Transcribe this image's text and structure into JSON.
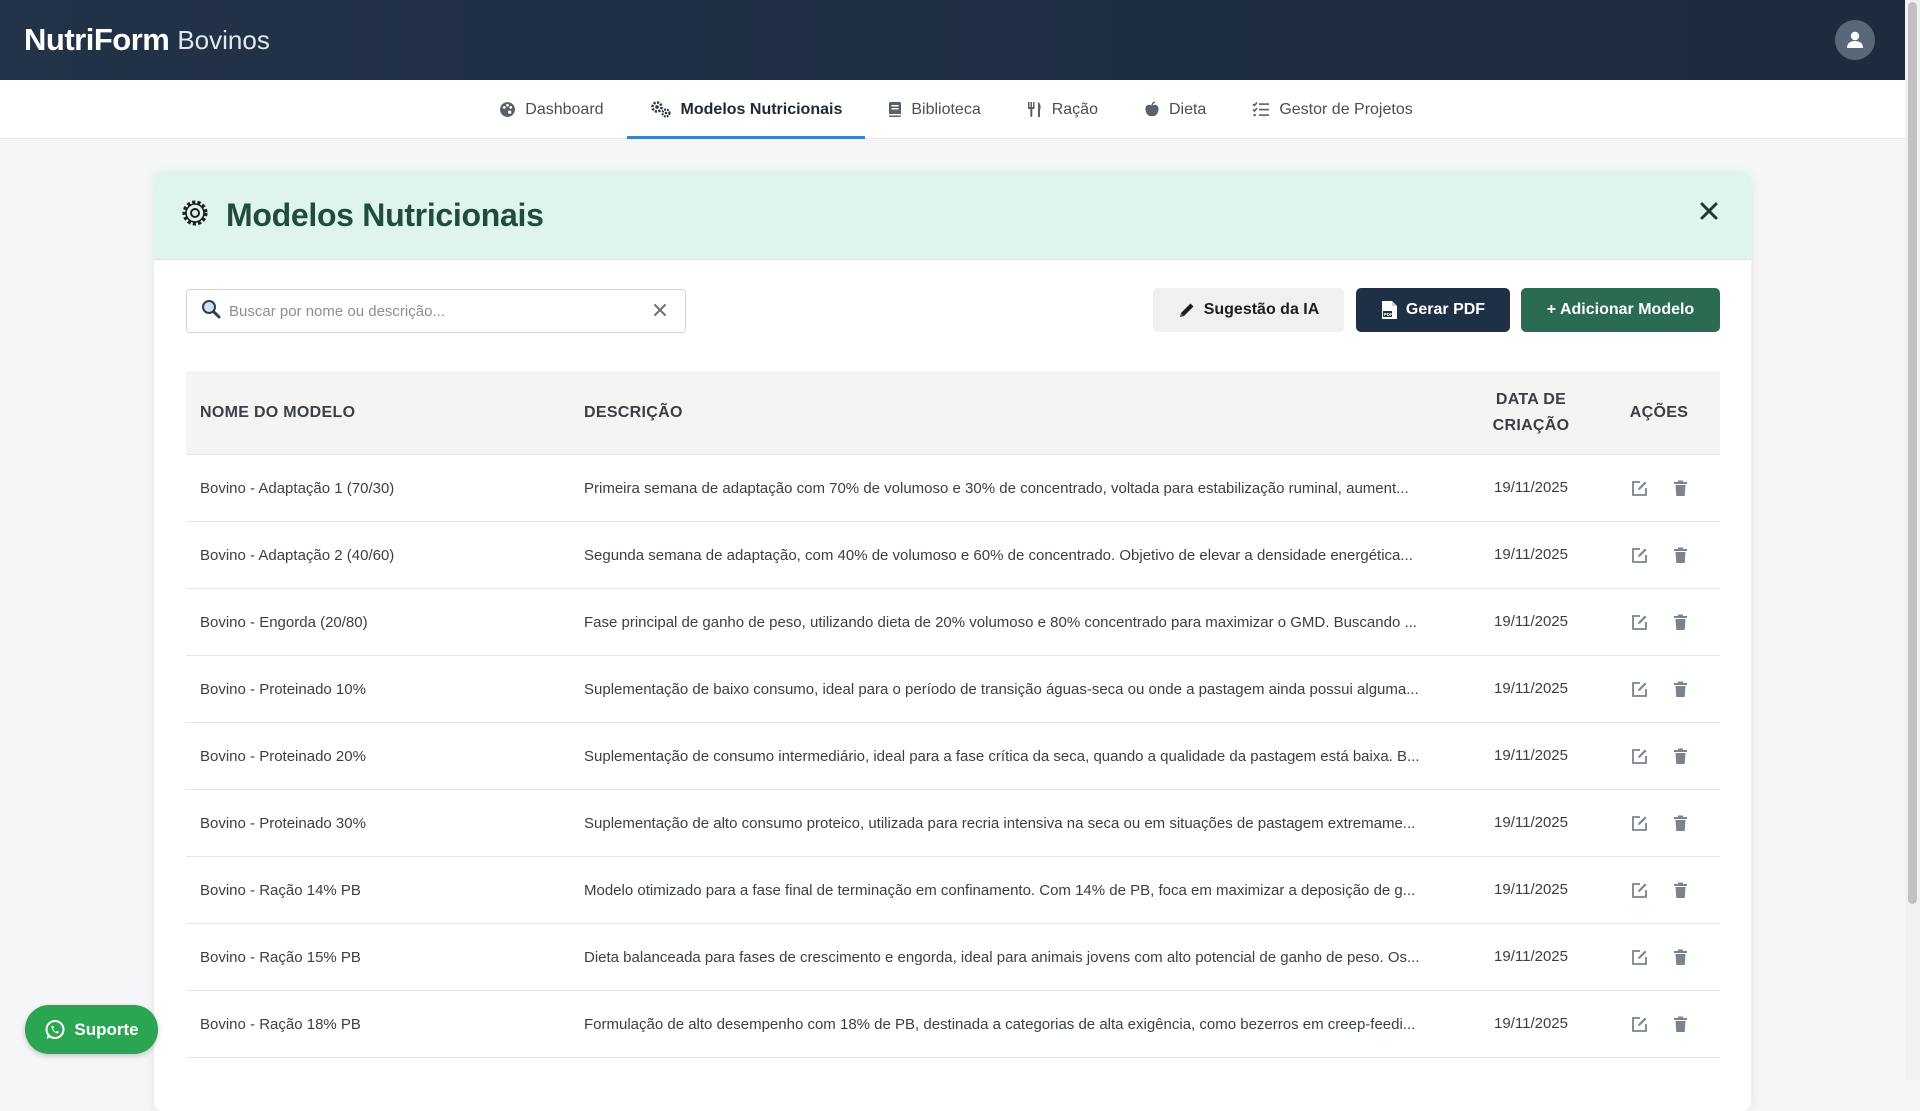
{
  "header": {
    "brand": "NutriForm",
    "brand_sub": "Bovinos",
    "profile_icon": "user-icon"
  },
  "nav": {
    "items": [
      {
        "label": "Dashboard",
        "icon": "palette-icon",
        "active": false
      },
      {
        "label": "Modelos Nutricionais",
        "icon": "gears-icon",
        "active": true
      },
      {
        "label": "Biblioteca",
        "icon": "book-icon",
        "active": false
      },
      {
        "label": "Ração",
        "icon": "utensils-icon",
        "active": false
      },
      {
        "label": "Dieta",
        "icon": "apple-icon",
        "active": false
      },
      {
        "label": "Gestor de Projetos",
        "icon": "list-check-icon",
        "active": false
      }
    ]
  },
  "panel": {
    "title": "Modelos Nutricionais",
    "icon": "gear-icon",
    "close_icon": "close-icon"
  },
  "toolbar": {
    "search_placeholder": "Buscar por nome ou descrição...",
    "search_value": "",
    "ia_label": "Sugestão da IA",
    "pdf_label": "Gerar PDF",
    "add_label": "+ Adicionar Modelo"
  },
  "table": {
    "headers": {
      "name": "NOME DO MODELO",
      "desc": "DESCRIÇÃO",
      "date": "DATA DE CRIAÇÃO",
      "actions": "AÇÕES"
    },
    "rows": [
      {
        "name": "Bovino - Adaptação 1 (70/30)",
        "desc": "Primeira semana de adaptação com 70% de volumoso e 30% de concentrado, voltada para estabilização ruminal, aument...",
        "date": "19/11/2025"
      },
      {
        "name": "Bovino - Adaptação 2 (40/60)",
        "desc": "Segunda semana de adaptação, com 40% de volumoso e 60% de concentrado. Objetivo de elevar a densidade energética...",
        "date": "19/11/2025"
      },
      {
        "name": "Bovino - Engorda (20/80)",
        "desc": "Fase principal de ganho de peso, utilizando dieta de 20% volumoso e 80% concentrado para maximizar o GMD. Buscando ...",
        "date": "19/11/2025"
      },
      {
        "name": "Bovino - Proteinado 10%",
        "desc": "Suplementação de baixo consumo, ideal para o período de transição águas-seca ou onde a pastagem ainda possui alguma...",
        "date": "19/11/2025"
      },
      {
        "name": "Bovino - Proteinado 20%",
        "desc": "Suplementação de consumo intermediário, ideal para a fase crítica da seca, quando a qualidade da pastagem está baixa. B...",
        "date": "19/11/2025"
      },
      {
        "name": "Bovino - Proteinado 30%",
        "desc": "Suplementação de alto consumo proteico, utilizada para recria intensiva na seca ou em situações de pastagem extremame...",
        "date": "19/11/2025"
      },
      {
        "name": "Bovino - Ração 14% PB",
        "desc": "Modelo otimizado para a fase final de terminação em confinamento. Com 14% de PB, foca em maximizar a deposição de g...",
        "date": "19/11/2025"
      },
      {
        "name": "Bovino - Ração 15% PB",
        "desc": "Dieta balanceada para fases de crescimento e engorda, ideal para animais jovens com alto potencial de ganho de peso. Os...",
        "date": "19/11/2025"
      },
      {
        "name": "Bovino - Ração 18% PB",
        "desc": "Formulação de alto desempenho com 18% de PB, destinada a categorias de alta exigência, como bezerros em creep-feedi...",
        "date": "19/11/2025"
      }
    ]
  },
  "support": {
    "label": "Suporte",
    "icon": "whatsapp-icon"
  },
  "colors": {
    "topbar": "#223247",
    "accent_nav": "#3b82d6",
    "panel_header_bg": "#dff4ec",
    "title_green": "#1f4d3a",
    "pdf_button": "#1f2f44",
    "add_button": "#2b6b52",
    "support_button": "#2aa652"
  }
}
